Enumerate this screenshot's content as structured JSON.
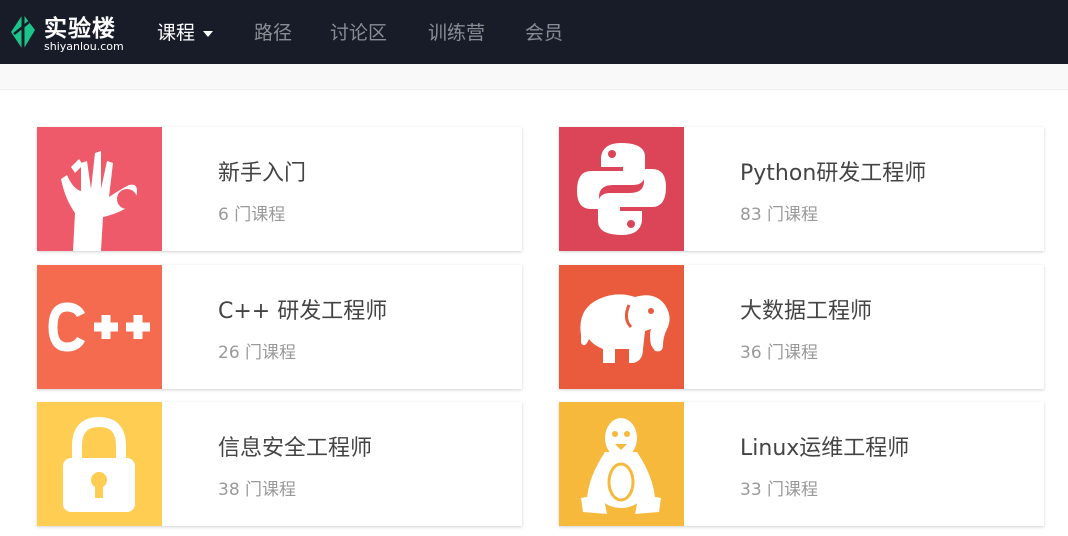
{
  "brand": {
    "name": "实验楼",
    "domain": "shiyanlou.com"
  },
  "nav": {
    "items": [
      {
        "label": "课程",
        "active": true,
        "dropdown": true
      },
      {
        "label": "路径"
      },
      {
        "label": "讨论区"
      },
      {
        "label": "训练营"
      },
      {
        "label": "会员"
      }
    ]
  },
  "paths": [
    {
      "title": "新手入门",
      "count": "6 门课程",
      "icon": "ok-hand-icon",
      "color": "#ee5a6a"
    },
    {
      "title": "Python研发工程师",
      "count": "83 门课程",
      "icon": "python-icon",
      "color": "#dc4558"
    },
    {
      "title": "C++ 研发工程师",
      "count": "26 门课程",
      "icon": "cpp-icon",
      "color": "#f56b4f"
    },
    {
      "title": "大数据工程师",
      "count": "36 门课程",
      "icon": "hadoop-elephant-icon",
      "color": "#ea5a3d"
    },
    {
      "title": "信息安全工程师",
      "count": "38 门课程",
      "icon": "lock-icon",
      "color": "#fecd51"
    },
    {
      "title": "Linux运维工程师",
      "count": "33 门课程",
      "icon": "linux-penguin-icon",
      "color": "#f6b93b"
    }
  ],
  "colors": {
    "navbar": "#171c28",
    "brand_green": "#1cc38a"
  }
}
